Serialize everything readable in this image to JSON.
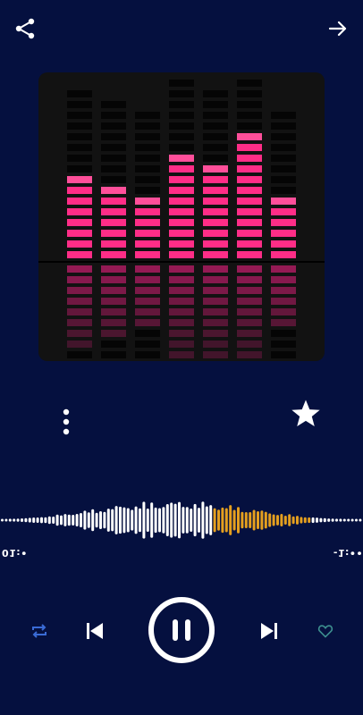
{
  "player": {
    "elapsed": "01:•",
    "remaining": "-1:••",
    "equalizer_levels": [
      0.45,
      0.42,
      0.38,
      0.57,
      0.52,
      0.71,
      0.36
    ]
  },
  "icons": {
    "share": "share-icon",
    "forward": "arrow-right-icon",
    "more": "more-vertical-icon",
    "favorite_star": "star-icon",
    "repeat": "repeat-icon",
    "previous": "skip-previous-icon",
    "pause": "pause-icon",
    "next": "skip-next-icon",
    "like": "heart-icon"
  },
  "colors": {
    "background": "#05103f",
    "played_wave": "#ffffff",
    "progress_wave": "#f0a81e",
    "unplayed_wave": "#ffffff",
    "eq_bar": "#ff2d87",
    "repeat_icon": "#3a6bd6",
    "heart_icon": "#3d8f8f"
  },
  "progress": {
    "played_fraction": 0.58,
    "highlight_fraction": 0.85
  }
}
